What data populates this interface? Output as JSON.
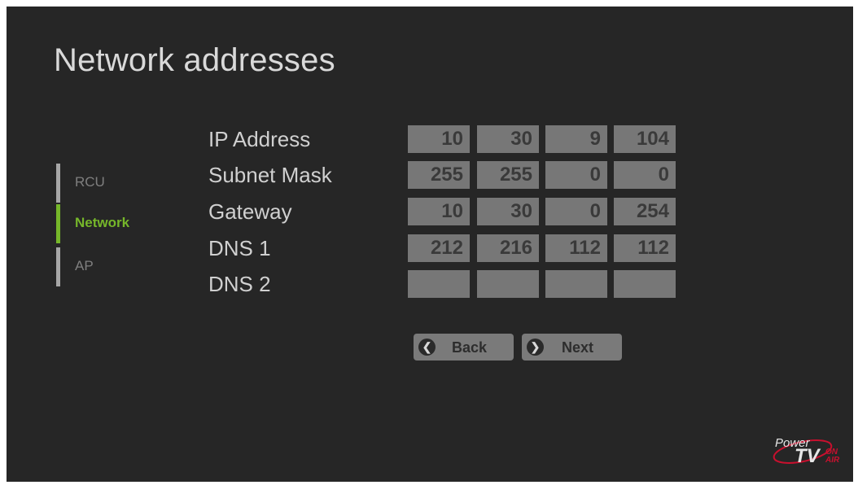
{
  "title": "Network addresses",
  "nav": {
    "items": [
      {
        "label": "RCU",
        "active": false
      },
      {
        "label": "Network",
        "active": true
      },
      {
        "label": "AP",
        "active": false
      }
    ]
  },
  "addresses": [
    {
      "label": "IP Address",
      "octets": [
        "10",
        "30",
        "9",
        "104"
      ]
    },
    {
      "label": "Subnet Mask",
      "octets": [
        "255",
        "255",
        "0",
        "0"
      ]
    },
    {
      "label": "Gateway",
      "octets": [
        "10",
        "30",
        "0",
        "254"
      ]
    },
    {
      "label": "DNS 1",
      "octets": [
        "212",
        "216",
        "112",
        "112"
      ]
    },
    {
      "label": "DNS 2",
      "octets": [
        "",
        "",
        "",
        ""
      ]
    }
  ],
  "buttons": {
    "back": "Back",
    "next": "Next"
  },
  "logo": {
    "power": "Power",
    "tv": "TV",
    "on": "ON",
    "air": "AIR"
  },
  "colors": {
    "accent": "#76b72a",
    "background": "#262626",
    "logo_red": "#c8102e"
  }
}
